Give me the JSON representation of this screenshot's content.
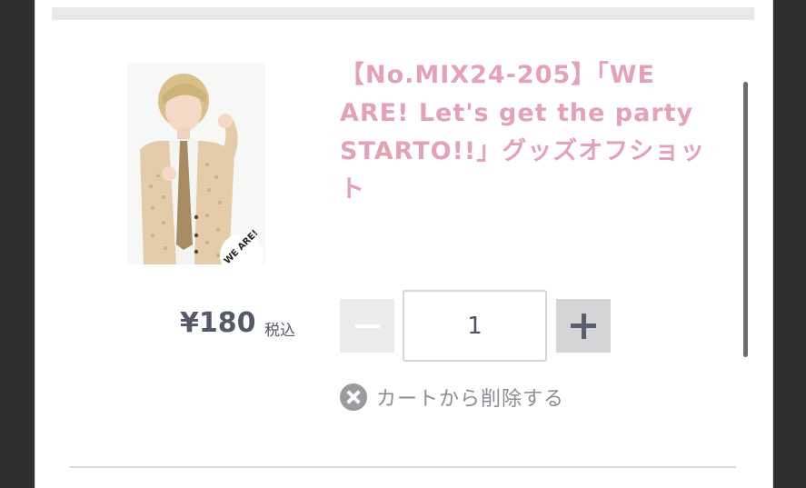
{
  "product": {
    "title": "【No.MIX24-205】「WE ARE! Let's get the party STARTO!!」グッズオフショット",
    "image_badge": "WE ARE!",
    "price": "¥180",
    "tax_label": "税込"
  },
  "quantity": {
    "value": "1"
  },
  "actions": {
    "remove_label": "カートから削除する",
    "minus_icon": "minus-icon",
    "plus_icon": "plus-icon",
    "remove_icon": "close-circle-icon"
  },
  "colors": {
    "title": "#e4a2b5",
    "price": "#555a69",
    "minus_bg": "#ececef",
    "plus_bg": "#d5d5d8",
    "outer_bg": "#2f2f2f"
  }
}
